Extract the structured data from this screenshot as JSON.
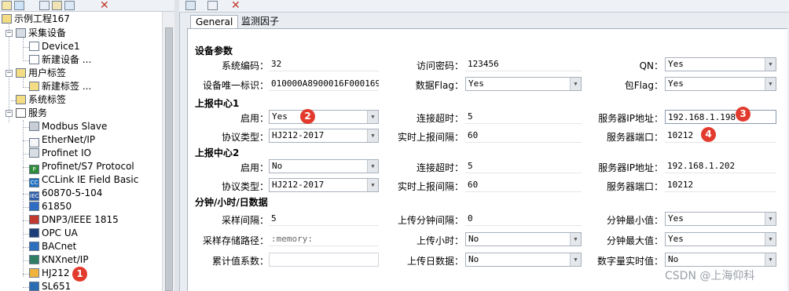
{
  "tree": {
    "root": "示例工程167",
    "collect": "采集设备",
    "device1": "Device1",
    "new_device": "新建设备 ...",
    "user_tags": "用户标签",
    "new_tag": "新建标签 ...",
    "system_tags": "系统标签",
    "services": "服务",
    "service_items": [
      "Modbus Slave",
      "EtherNet/IP",
      "Profinet IO",
      "Profinet/S7 Protocol",
      "CCLink IE Field Basic",
      "60870-5-104",
      "61850",
      "DNP3/IEEE 1815",
      "OPC UA",
      "BACnet",
      "KNXnet/IP",
      "HJ212",
      "SL651"
    ],
    "service_icon_text": [
      "",
      "N",
      "",
      "P",
      "CC",
      "IEC",
      "",
      "",
      "",
      "",
      "",
      "",
      ""
    ]
  },
  "tabs": {
    "general": "General",
    "factors": "监测因子"
  },
  "sections": {
    "device_params": "设备参数",
    "center1": "上报中心1",
    "center2": "上报中心2",
    "minute_data": "分钟/小时/日数据"
  },
  "device": {
    "system_code_label": "系统编码：",
    "system_code": "32",
    "access_pwd_label": "访问密码：",
    "access_pwd": "123456",
    "qn_label": "QN：",
    "qn": "Yes",
    "unique_id_label": "设备唯一标识：",
    "unique_id": "010000A8900016F000169D",
    "data_flag_label": "数据Flag：",
    "data_flag": "Yes",
    "pkt_flag_label": "包Flag：",
    "pkt_flag": "Yes"
  },
  "center1": {
    "enable_label": "启用：",
    "enable": "Yes",
    "timeout_label": "连接超时：",
    "timeout": "5",
    "ip_label": "服务器IP地址：",
    "ip": "192.168.1.198",
    "protocol_label": "协议类型：",
    "protocol": "HJ212-2017",
    "interval_label": "实时上报间隔：",
    "interval": "60",
    "port_label": "服务器端口：",
    "port": "10212"
  },
  "center2": {
    "enable_label": "启用：",
    "enable": "No",
    "timeout_label": "连接超时：",
    "timeout": "5",
    "ip_label": "服务器IP地址：",
    "ip": "192.168.1.202",
    "protocol_label": "协议类型：",
    "protocol": "HJ212-2017",
    "interval_label": "实时上报间隔：",
    "interval": "60",
    "port_label": "服务器端口：",
    "port": "10212"
  },
  "minute": {
    "sample_interval_label": "采样间隔：",
    "sample_interval": "5",
    "upload_min_interval_label": "上传分钟间隔：",
    "upload_min_interval": "0",
    "min_value_label": "分钟最小值：",
    "min_value": "Yes",
    "storage_path_label": "采样存储路径：",
    "storage_path": ":memory:",
    "upload_hour_label": "上传小时：",
    "upload_hour": "No",
    "max_value_label": "分钟最大值：",
    "max_value": "Yes",
    "cumulative_label": "累计值系数：",
    "cumulative": "",
    "upload_day_label": "上传日数据：",
    "upload_day": "No",
    "digital_label": "数字量实时值：",
    "digital": "No"
  },
  "badges": [
    "1",
    "2",
    "3",
    "4"
  ],
  "watermark": "CSDN @上海仰科",
  "colors": {
    "badge": "#e23b2e",
    "panel": "#e9edf2"
  }
}
